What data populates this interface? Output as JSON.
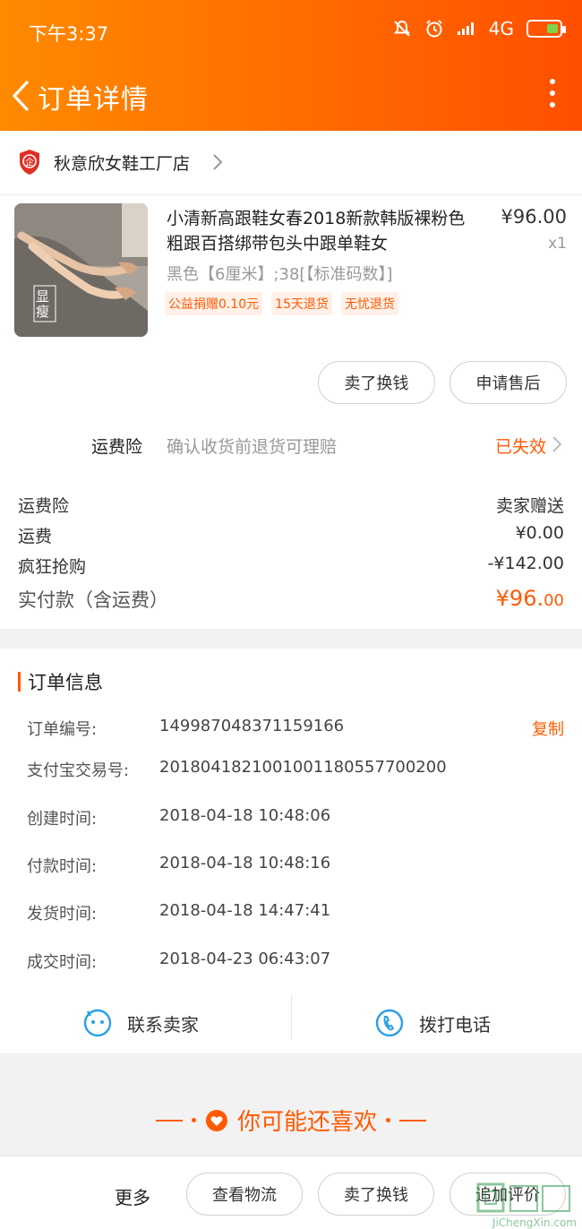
{
  "status_bar": {
    "time": "下午3:37",
    "network": "4G"
  },
  "header": {
    "title": "订单详情"
  },
  "shop": {
    "name": "秋意欣女鞋工厂店"
  },
  "product": {
    "title": "小清新高跟鞋女春2018新款韩版裸粉色粗跟百搭绑带包头中跟单鞋女",
    "price": "¥96.00",
    "quantity": "x1",
    "sku": "黑色【6厘米】;38[【标准码数】]",
    "thumb_label": "显瘦",
    "tags": [
      "公益捐赠0.10元",
      "15天退货",
      "无忧退货"
    ]
  },
  "actions": {
    "sell": "卖了换钱",
    "after_sale": "申请售后"
  },
  "insurance": {
    "label": "运费险",
    "desc": "确认收货前退货可理赔",
    "status": "已失效"
  },
  "fees": [
    {
      "label": "运费险",
      "value": "卖家赠送"
    },
    {
      "label": "运费",
      "value": "¥0.00"
    },
    {
      "label": "疯狂抢购",
      "value": "-¥142.00"
    }
  ],
  "total": {
    "label": "实付款（含运费）",
    "value_main": "¥96.",
    "value_dec": "00"
  },
  "order_info": {
    "title": "订单信息",
    "copy_label": "复制",
    "rows": [
      {
        "label": "订单编号:",
        "value": "149987048371159166"
      },
      {
        "label": "支付宝交易号:",
        "value": "2018041821001001180557700200"
      },
      {
        "label": "创建时间:",
        "value": "2018-04-18 10:48:06"
      },
      {
        "label": "付款时间:",
        "value": "2018-04-18 10:48:16"
      },
      {
        "label": "发货时间:",
        "value": "2018-04-18 14:47:41"
      },
      {
        "label": "成交时间:",
        "value": "2018-04-23 06:43:07"
      }
    ]
  },
  "contact": {
    "seller": "联系卖家",
    "phone": "拨打电话"
  },
  "recommend": {
    "title": "你可能还喜欢"
  },
  "bottom_bar": {
    "more": "更多",
    "logistics": "查看物流",
    "sell": "卖了换钱",
    "review": "追加评价"
  },
  "watermark": {
    "text": "JiChengXin.com"
  },
  "colors": {
    "accent": "#ff5a00",
    "header_start": "#ff8a00",
    "header_end": "#ff4f00"
  }
}
